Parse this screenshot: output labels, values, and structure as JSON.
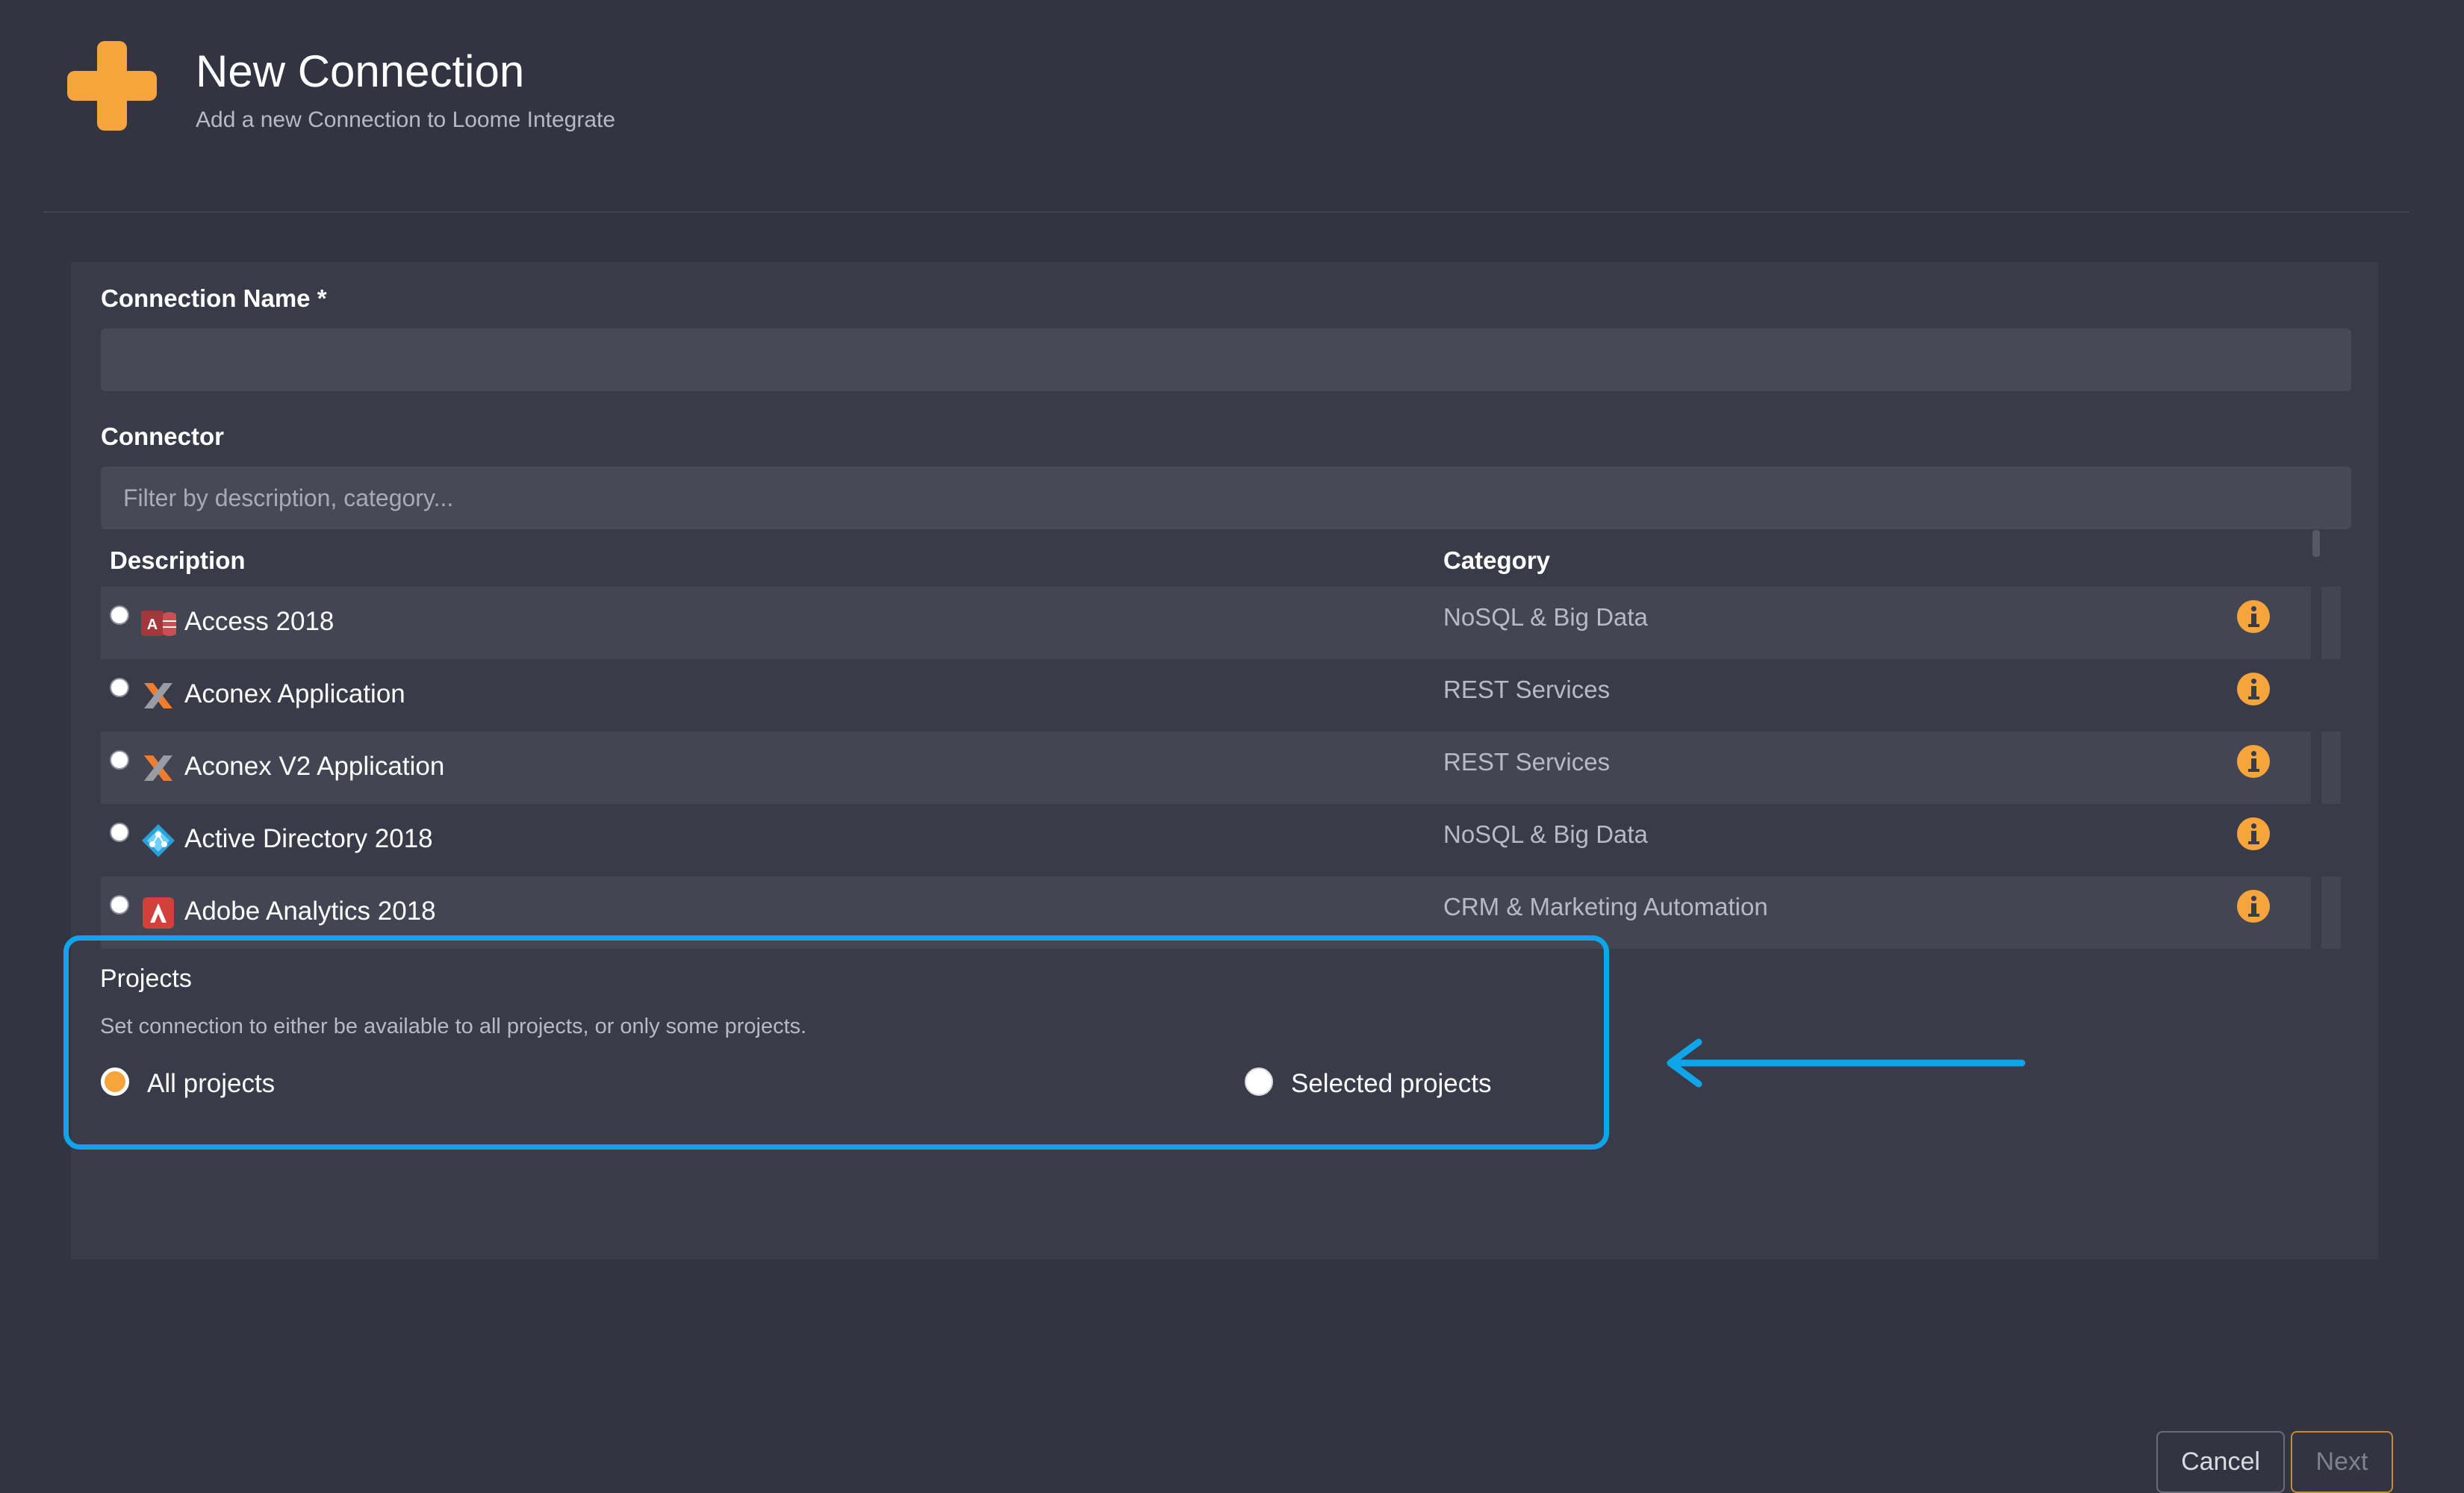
{
  "header": {
    "title": "New Connection",
    "subtitle": "Add a new Connection to Loome Integrate",
    "icon": "plus-icon",
    "accent_color": "#f5a53c"
  },
  "form": {
    "connection_name_label": "Connection Name *",
    "connection_name_value": "",
    "connector_label": "Connector",
    "connector_filter_placeholder": "Filter by description, category...",
    "connector_filter_value": ""
  },
  "connector_table": {
    "columns": {
      "description": "Description",
      "category": "Category"
    },
    "rows": [
      {
        "description": "Access 2018",
        "category": "NoSQL & Big Data",
        "icon": "access-icon"
      },
      {
        "description": "Aconex Application",
        "category": "REST Services",
        "icon": "aconex-icon"
      },
      {
        "description": "Aconex V2 Application",
        "category": "REST Services",
        "icon": "aconex-icon"
      },
      {
        "description": "Active Directory 2018",
        "category": "NoSQL & Big Data",
        "icon": "active-directory-icon"
      },
      {
        "description": "Adobe Analytics 2018",
        "category": "CRM & Marketing Automation",
        "icon": "adobe-icon"
      }
    ]
  },
  "projects": {
    "title": "Projects",
    "description": "Set connection to either be available to all projects, or only some projects.",
    "options": [
      {
        "label": "All projects",
        "selected": true
      },
      {
        "label": "Selected projects",
        "selected": false
      }
    ],
    "highlight_color": "#0ea5ea"
  },
  "buttons": {
    "cancel": "Cancel",
    "next": "Next"
  }
}
